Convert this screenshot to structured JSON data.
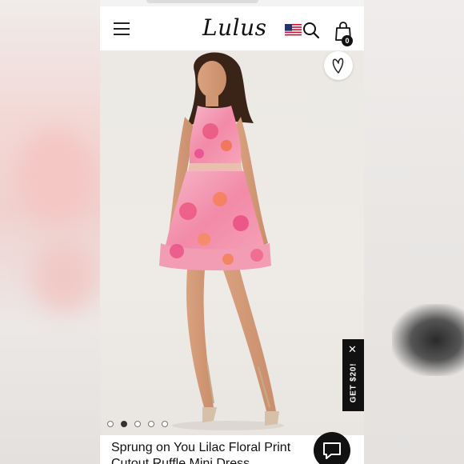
{
  "header": {
    "logo_text": "Lulus",
    "menu_icon": "hamburger-menu-icon",
    "flag_icon": "us-flag-icon",
    "search_icon": "search-icon",
    "bag_icon": "shopping-bag-icon",
    "bag_count": "0"
  },
  "product": {
    "title": "Sprung on You Lilac Floral Print Cutout Ruffle Mini Dress",
    "wishlist_icon": "heart-icon"
  },
  "carousel": {
    "total": 5,
    "active_index": 1
  },
  "promo": {
    "label": "GET $20!",
    "close_icon": "close-icon"
  },
  "chat": {
    "icon": "chat-bubble-icon"
  },
  "colors": {
    "brand": "#111111",
    "dress_pink": "#f07aa0",
    "background": "#ece9e4"
  }
}
